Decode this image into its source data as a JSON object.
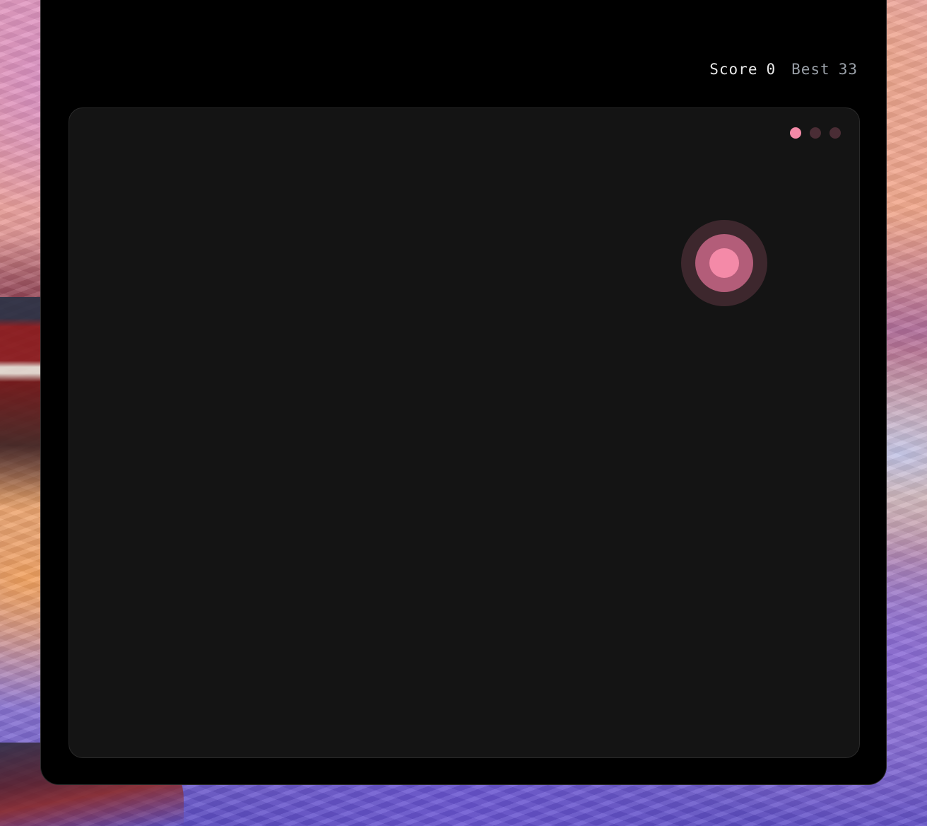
{
  "hud": {
    "score_label": "Score",
    "score_value": "0",
    "best_label": "Best",
    "best_value": "33"
  },
  "lives": {
    "total": 3,
    "remaining": 1,
    "active_color": "#f48aa8",
    "inactive_color": "#4a2d35"
  },
  "target": {
    "outer_color": "#3d272d",
    "mid_color": "#b35d79",
    "core_color": "#f48aa8"
  },
  "colors": {
    "window_bg": "#000000",
    "board_bg": "#141414",
    "score_text": "#e9e9e9",
    "best_text": "#9aa0a8"
  }
}
